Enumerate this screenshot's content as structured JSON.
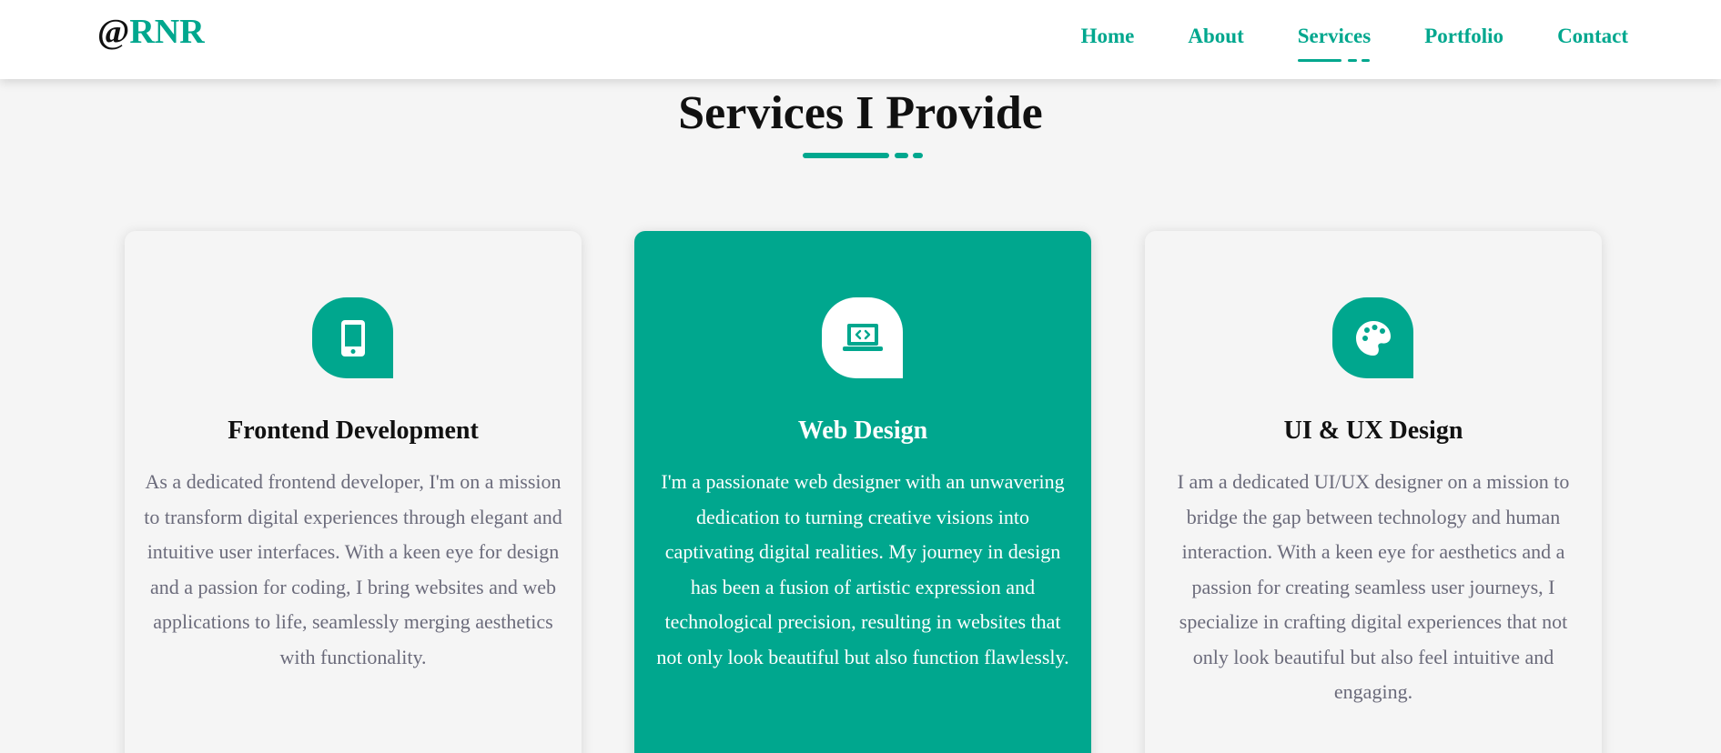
{
  "logo": {
    "at": "@",
    "name": "RNR"
  },
  "nav": {
    "items": [
      {
        "label": "Home"
      },
      {
        "label": "About"
      },
      {
        "label": "Services"
      },
      {
        "label": "Portfolio"
      },
      {
        "label": "Contact"
      }
    ],
    "active": "Services"
  },
  "section": {
    "title": "Services I Provide"
  },
  "cards": [
    {
      "icon": "mobile-phone-icon",
      "title": "Frontend Development",
      "text": "As a dedicated frontend developer, I'm on a mission to transform digital experiences through elegant and intuitive user interfaces. With a keen eye for design and a passion for coding, I bring websites and web applications to life, seamlessly merging aesthetics with functionality."
    },
    {
      "icon": "laptop-code-icon",
      "title": "Web Design",
      "text": "I'm a passionate web designer with an unwavering dedication to turning creative visions into captivating digital realities. My journey in design has been a fusion of artistic expression and technological precision, resulting in websites that not only look beautiful but also function flawlessly."
    },
    {
      "icon": "palette-icon",
      "title": "UI & UX Design",
      "text": "I am a dedicated UI/UX designer on a mission to bridge the gap between technology and human interaction. With a keen eye for aesthetics and a passion for creating seamless user journeys, I specialize in crafting digital experiences that not only look beautiful but also feel intuitive and engaging."
    }
  ],
  "colors": {
    "accent": "#00a78e",
    "background": "#f5f5f5",
    "heading": "#111111",
    "body_text": "#6b6b7b"
  }
}
